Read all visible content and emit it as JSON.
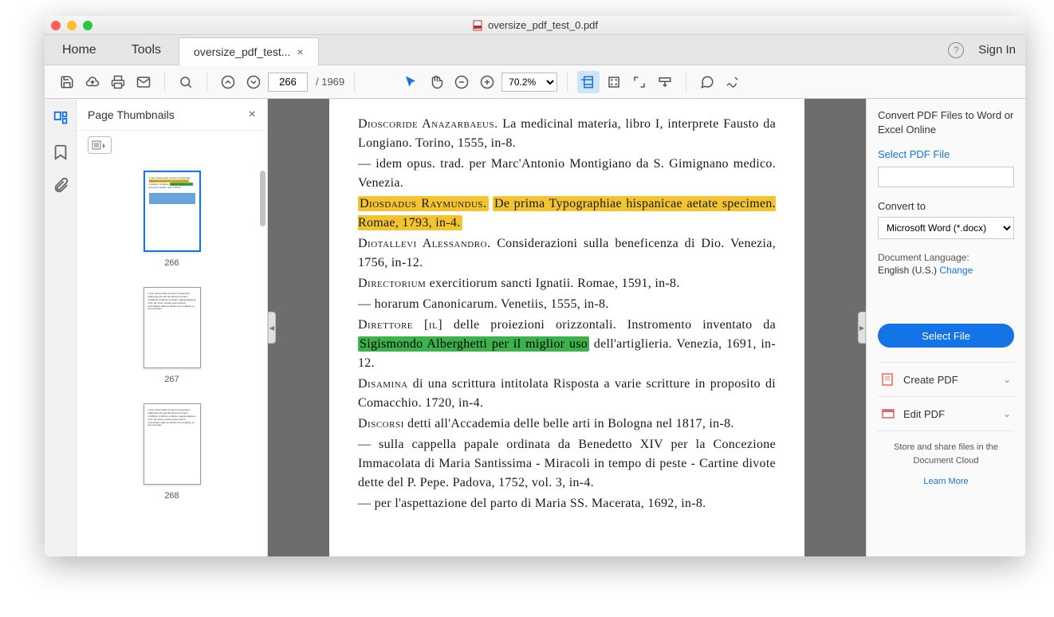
{
  "window": {
    "title": "oversize_pdf_test_0.pdf"
  },
  "tabs": {
    "home": "Home",
    "tools": "Tools",
    "file": "oversize_pdf_test...",
    "signin": "Sign In"
  },
  "toolbar": {
    "page_current": "266",
    "page_total": "/  1969",
    "zoom": "70.2%"
  },
  "thumbs": {
    "title": "Page Thumbnails",
    "items": [
      {
        "num": "266"
      },
      {
        "num": "267"
      },
      {
        "num": "268"
      }
    ]
  },
  "doc": {
    "l1a": "Dioscoride Anazarbaeus.",
    "l1b": " La medicinal materia, libro I, interprete Fausto da Longiano. Torino, 1555, in-8.",
    "l2": "— idem opus. trad. per Marc'Antonio Montigiano da S. Gimignano medico. Venezia.",
    "l3a": "Diosdadus Raymundus.",
    "l3b": "De prima Typographiae hispanicae aetate specimen. Romae, 1793, in-4.",
    "l4a": "Diotallevi Alessandro.",
    "l4b": " Considerazioni sulla beneficenza di Dio. Venezia, 1756, in-12.",
    "l5a": "Directorium",
    "l5b": " exercitiorum sancti Ignatii. Romae, 1591, in-8.",
    "l6": "— horarum Canonicarum. Venetiis, 1555, in-8.",
    "l7a": "Direttore [il]",
    "l7b": " delle proiezioni orizzontali. Instromento inventato da ",
    "l7c": "Sigismondo Alberghetti per il miglior uso",
    "l7d": " dell'artiglieria. Venezia, 1691, in-12.",
    "l8a": "Disamina",
    "l8b": " di una scrittura intitolata Risposta a varie scritture in proposito di Comacchio. 1720, in-4.",
    "l9a": "Discorsi",
    "l9b": " detti all'Accademia delle belle arti in Bologna nel 1817, in-8.",
    "l10": "— sulla cappella papale ordinata da Benedetto XIV per la Concezione Immacolata di Maria Santissima - Miracoli in tempo di peste - Cartine divote dette del P. Pepe. Padova, 1752, vol. 3, in-4.",
    "l11": "— per l'aspettazione del parto di Maria SS. Macerata, 1692, in-8."
  },
  "rp": {
    "title": "Convert PDF Files to Word or Excel Online",
    "select_file_link": "Select PDF File",
    "convert_to": "Convert to",
    "convert_opt": "Microsoft Word (*.docx)",
    "doc_lang": "Document Language:",
    "doc_lang_val": "English (U.S.)  ",
    "change": "Change",
    "select_btn": "Select File",
    "create_pdf": "Create PDF",
    "edit_pdf": "Edit PDF",
    "footer1": "Store and share files in the",
    "footer2": "Document Cloud",
    "learn": "Learn More"
  }
}
